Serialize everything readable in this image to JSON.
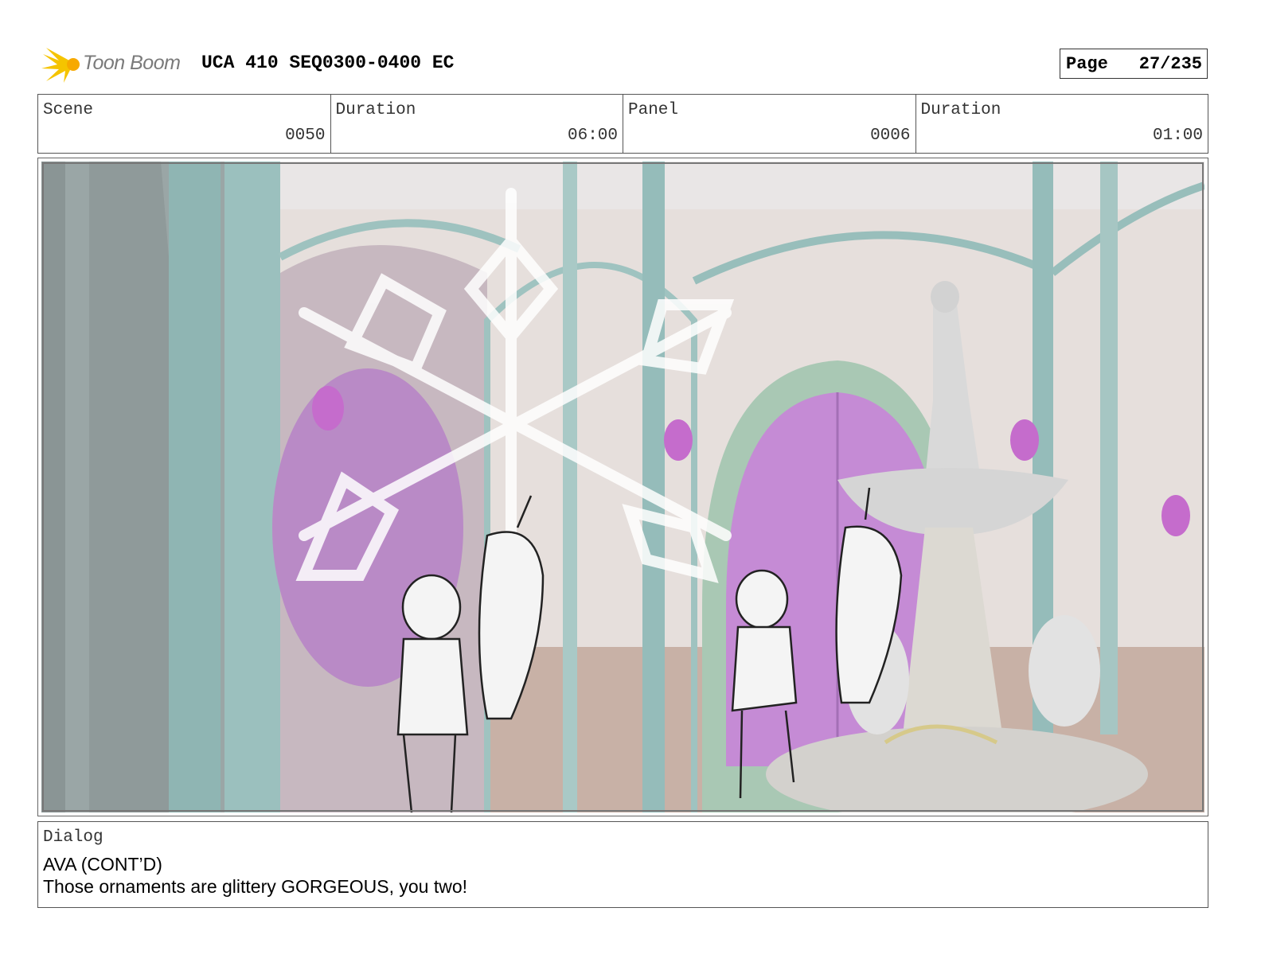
{
  "header": {
    "logo_text": "Toon Boom",
    "title": "UCA 410 SEQ0300-0400 EC",
    "page_label": "Page",
    "page_number": "27/235"
  },
  "info": {
    "scene_label": "Scene",
    "scene_value": "0050",
    "scene_duration_label": "Duration",
    "scene_duration_value": "06:00",
    "panel_label": "Panel",
    "panel_value": "0006",
    "panel_duration_label": "Duration",
    "panel_duration_value": "01:00"
  },
  "dialog": {
    "label": "Dialog",
    "speaker": "AVA (CONT’D)",
    "line": "Those ornaments are glittery GORGEOUS, you two!"
  },
  "colors": {
    "logo_yellow": "#f5c400",
    "teal_pillar": "#8fb7b5",
    "magenta_window": "#c98ad6",
    "wall": "#e4dcd8",
    "floor": "#c7b0a5"
  }
}
